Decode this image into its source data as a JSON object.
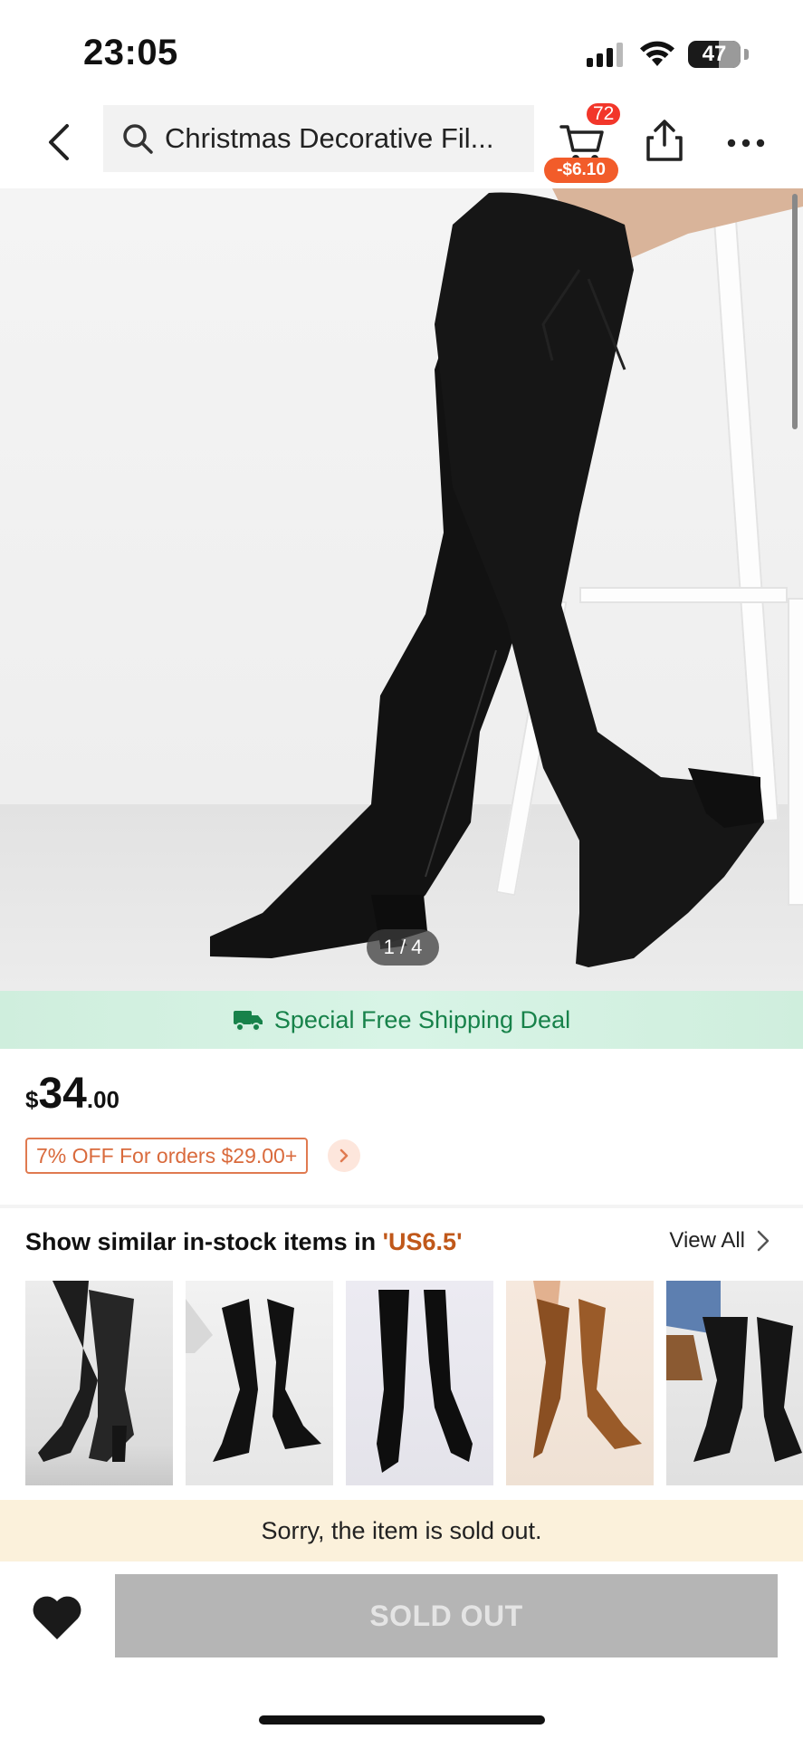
{
  "status_bar": {
    "time": "23:05",
    "battery": "47",
    "battery_level": 0.47
  },
  "header": {
    "search_text": "Christmas Decorative Fil...",
    "cart_count": "72",
    "cart_discount": "-$6.10",
    "icons": [
      "back-icon",
      "search-icon",
      "cart-icon",
      "share-icon",
      "more-icon"
    ]
  },
  "gallery": {
    "counter": "1 / 4",
    "current": 1,
    "total": 4
  },
  "shipping": {
    "label": "Special Free Shipping Deal",
    "color": "#17824a"
  },
  "price": {
    "currency": "$",
    "integer": "34",
    "decimal": ".00",
    "coupon": "7% OFF For orders $29.00+",
    "coupon_color": "#d96a3c"
  },
  "similar": {
    "title_prefix": "Show similar in-stock items in ",
    "size_label": "'US6.5'",
    "view_all": "View All",
    "items": [
      {
        "name": "black-suede-boot-chair"
      },
      {
        "name": "black-knit-boot-stool"
      },
      {
        "name": "black-stretch-boot"
      },
      {
        "name": "brown-suede-boot"
      },
      {
        "name": "black-boot-with-bag"
      }
    ]
  },
  "notice": {
    "sold_out_message": "Sorry, the item is sold out."
  },
  "bottom_bar": {
    "sold_out_label": "SOLD OUT",
    "button_color": "#b5b5b5"
  }
}
